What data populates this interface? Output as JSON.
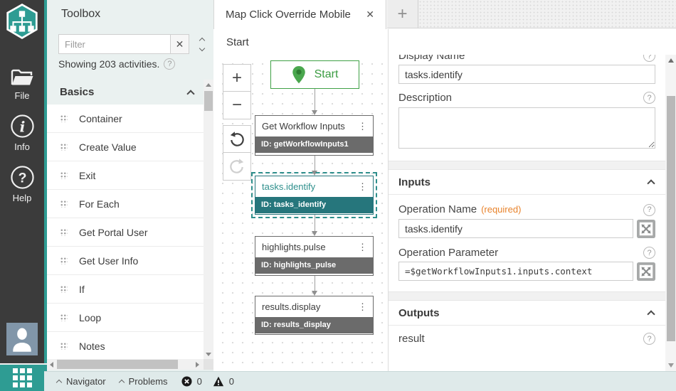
{
  "glyphs": {
    "help": "?",
    "info": "i",
    "ellipsis": "⋮",
    "close": "✕",
    "plus": "+",
    "zoom_in": "+",
    "zoom_out": "−"
  },
  "colors": {
    "brand_teal": "#2e9c93",
    "node_teal": "#26767c",
    "start_green": "#3fa046",
    "required_orange": "#e8832c",
    "sidebar_dark": "#3b3b3b",
    "statusbar_bg": "#dfeaea"
  },
  "sidebar": {
    "items": [
      {
        "label": "File"
      },
      {
        "label": "Info"
      },
      {
        "label": "Help"
      }
    ]
  },
  "toolbox": {
    "title": "Toolbox",
    "filter_placeholder": "Filter",
    "summary": "Showing 203 activities.",
    "section_label": "Basics",
    "items": [
      "Container",
      "Create Value",
      "Exit",
      "For Each",
      "Get Portal User",
      "Get User Info",
      "If",
      "Loop",
      "Notes"
    ]
  },
  "tabs": {
    "active_label": "Map Click Override Mobile"
  },
  "breadcrumb": {
    "label": "Start"
  },
  "canvas": {
    "start_label": "Start",
    "id_prefix": "ID:",
    "nodes": [
      {
        "title": "Get Workflow Inputs",
        "id": "getWorkflowInputs1"
      },
      {
        "title": "tasks.identify",
        "id": "tasks_identify"
      },
      {
        "title": "highlights.pulse",
        "id": "highlights_pulse"
      },
      {
        "title": "results.display",
        "id": "results_display"
      }
    ]
  },
  "properties": {
    "display_name": {
      "label": "Display Name",
      "value": "tasks.identify"
    },
    "description": {
      "label": "Description",
      "value": ""
    },
    "inputs": {
      "section": "Inputs",
      "operation_name": {
        "label": "Operation Name",
        "required": "(required)",
        "value": "tasks.identify"
      },
      "operation_parameter": {
        "label": "Operation Parameter",
        "value": "=$getWorkflowInputs1.inputs.context"
      }
    },
    "outputs": {
      "section": "Outputs",
      "result_label": "result"
    }
  },
  "statusbar": {
    "navigator": "Navigator",
    "problems": "Problems",
    "error_count": "0",
    "warning_count": "0"
  }
}
